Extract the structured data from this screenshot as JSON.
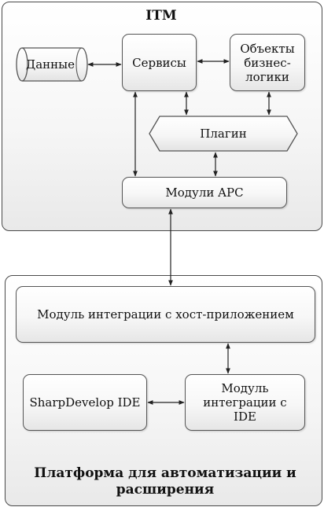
{
  "itm": {
    "title": "ITM",
    "data_label": "Данные",
    "services_label": "Сервисы",
    "business_objects_label": "Объекты бизнес-логики",
    "plugin_label": "Плагин",
    "apc_modules_label": "Модули APC"
  },
  "platform": {
    "title": "Платформа для автоматизации и расширения",
    "host_integration_label": "Модуль интеграции с хост-приложением",
    "sharpdevelop_label": "SharpDevelop IDE",
    "ide_integration_label": "Модуль интеграции с IDE"
  },
  "colors": {
    "stroke": "#4a4a4a",
    "fill_top": "#ffffff",
    "fill_bottom": "#e6e6e6"
  }
}
